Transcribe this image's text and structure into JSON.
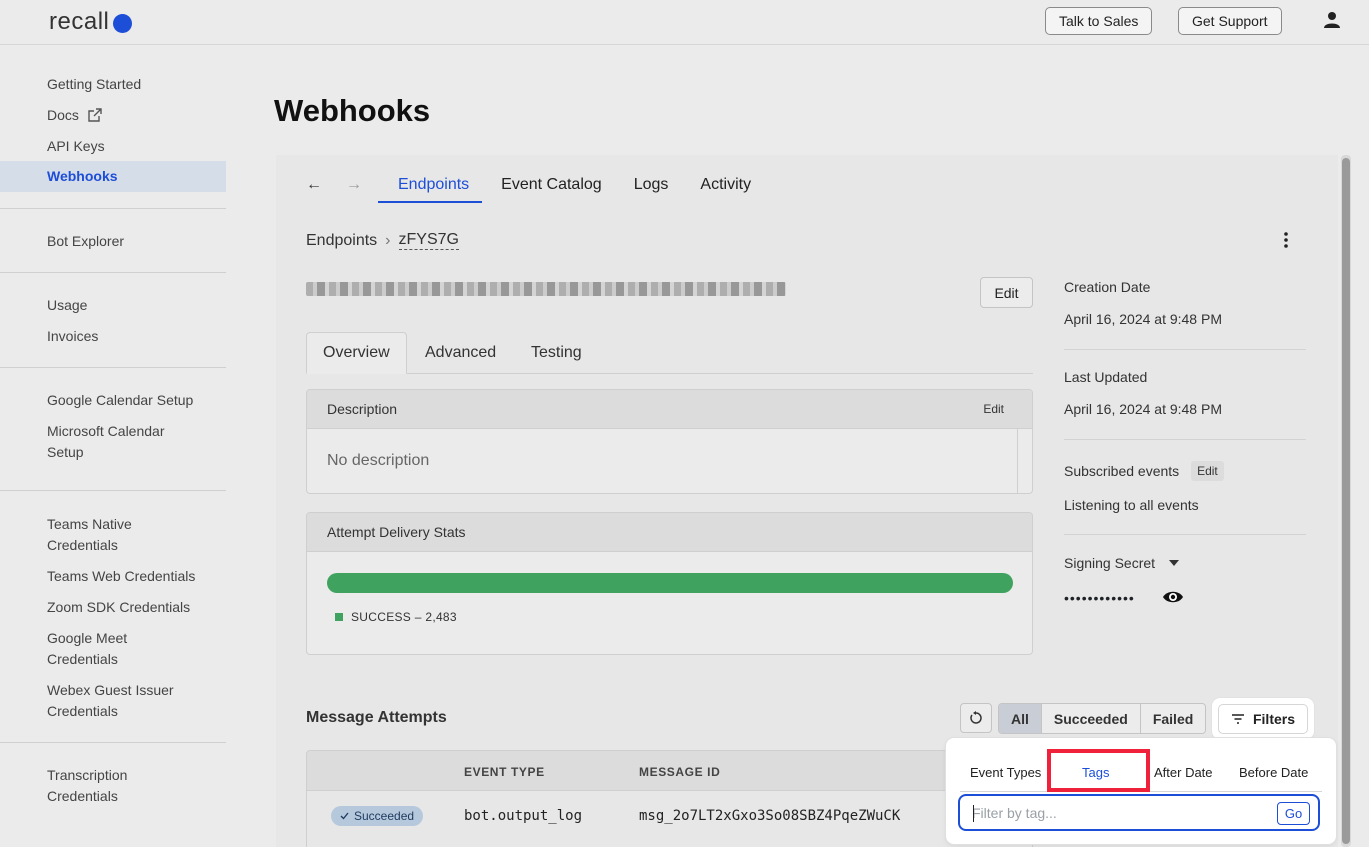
{
  "header": {
    "logo_text": "recall",
    "talk_to_sales": "Talk to Sales",
    "get_support": "Get Support"
  },
  "sidebar": {
    "items": [
      {
        "label": "Getting Started"
      },
      {
        "label": "Docs"
      },
      {
        "label": "API Keys"
      },
      {
        "label": "Webhooks"
      },
      {
        "label": "Bot Explorer"
      },
      {
        "label": "Usage"
      },
      {
        "label": "Invoices"
      },
      {
        "label": "Google Calendar Setup"
      },
      {
        "label": "Microsoft Calendar Setup"
      },
      {
        "label": "Teams Native Credentials"
      },
      {
        "label": "Teams Web Credentials"
      },
      {
        "label": "Zoom SDK Credentials"
      },
      {
        "label": "Google Meet Credentials"
      },
      {
        "label": "Webex Guest Issuer Credentials"
      },
      {
        "label": "Transcription Credentials"
      }
    ]
  },
  "page": {
    "title": "Webhooks",
    "tabs": [
      "Endpoints",
      "Event Catalog",
      "Logs",
      "Activity"
    ],
    "breadcrumb": {
      "root": "Endpoints",
      "separator": "›",
      "current": "zFYS7G"
    },
    "edit_label": "Edit",
    "sub_tabs": [
      "Overview",
      "Advanced",
      "Testing"
    ],
    "description": {
      "title": "Description",
      "edit": "Edit",
      "body": "No description"
    },
    "stats": {
      "title": "Attempt Delivery Stats",
      "legend": "SUCCESS – 2,483",
      "success_fraction": 1.0
    },
    "meta": {
      "creation_label": "Creation Date",
      "creation_value": "April 16, 2024 at 9:48 PM",
      "updated_label": "Last Updated",
      "updated_value": "April 16, 2024 at 9:48 PM",
      "subscribed_label": "Subscribed events",
      "subscribed_edit": "Edit",
      "subscribed_value": "Listening to all events",
      "secret_label": "Signing Secret",
      "secret_mask": "••••••••••••"
    },
    "messages": {
      "title": "Message Attempts",
      "segments": [
        "All",
        "Succeeded",
        "Failed"
      ],
      "filters_label": "Filters",
      "columns": [
        "EVENT TYPE",
        "MESSAGE ID"
      ],
      "rows": [
        {
          "status": "Succeeded",
          "event_type": "bot.output_log",
          "message_id": "msg_2o7LT2xGxo3So08SBZ4PqeZWuCK"
        }
      ]
    }
  },
  "filter_popover": {
    "tabs": [
      "Event Types",
      "Tags",
      "After Date",
      "Before Date"
    ],
    "placeholder": "Filter by tag...",
    "go": "Go"
  },
  "colors": {
    "accent": "#1d4ed8",
    "success": "#3fa35f",
    "highlight": "#f0213a"
  }
}
